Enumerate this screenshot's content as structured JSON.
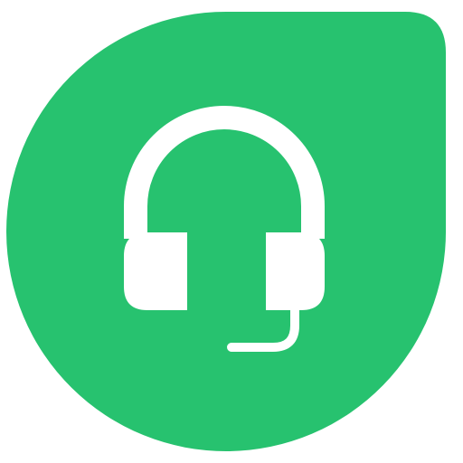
{
  "icon": {
    "name": "headset-icon",
    "shape": "leaf",
    "colors": {
      "background": "#ffffff",
      "leaf": "#27c26f",
      "headset": "#ffffff"
    }
  }
}
